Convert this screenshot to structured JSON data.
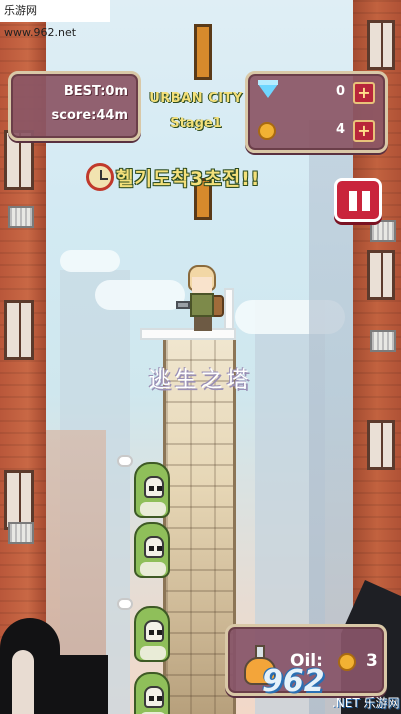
{
  "watermark": {
    "text": "乐游网 www.962.net"
  },
  "hud": {
    "best_label": "BEST:0m",
    "score_label": "score:44m",
    "stage_name": "URBAN CITY",
    "stage_number": "Stage1",
    "gems": {
      "icon": "diamond-icon",
      "value": "0",
      "add_label": "+"
    },
    "coins": {
      "icon": "coin-icon",
      "value": "4",
      "add_label": "+"
    },
    "pause_icon": "pause-icon"
  },
  "alert": {
    "icon": "alarm-clock-icon",
    "text": "헬기도착3초전!!"
  },
  "tower": {
    "title": "逃生之塔"
  },
  "oil": {
    "icon": "oil-flask-icon",
    "label": "Oil:",
    "coin_icon": "coin-icon",
    "value": "3"
  },
  "logo": {
    "number": "962",
    "sub": ".NET 乐游网"
  },
  "colors": {
    "panel": "#8b5665",
    "panel_border": "#d9c8a7",
    "accent_yellow": "#f4e07a",
    "pause_red": "#c9243b"
  }
}
